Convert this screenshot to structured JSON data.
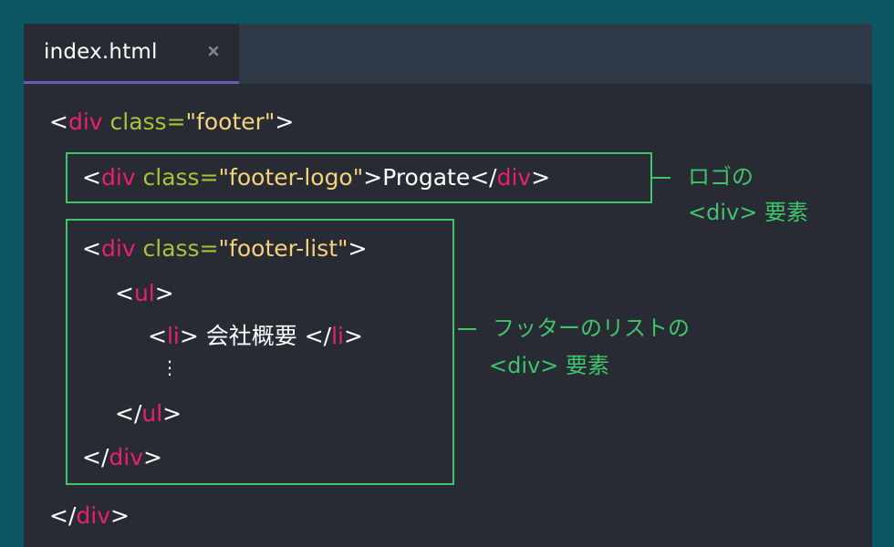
{
  "tab": {
    "filename": "index.html",
    "close_icon": "close-icon"
  },
  "code": {
    "line1": {
      "lt": "<",
      "tag": "div",
      "attr": " class=",
      "str": "\"footer\"",
      "gt": ">"
    },
    "line2": {
      "lt": "<",
      "tag": "div",
      "attr": " class=",
      "str": "\"footer-logo\"",
      "gt": ">",
      "text": "Progate",
      "close_lt": "</",
      "close_tag": "div",
      "close_gt": ">"
    },
    "line3": {
      "lt": "<",
      "tag": "div",
      "attr": " class=",
      "str": "\"footer-list\"",
      "gt": ">"
    },
    "line4": {
      "lt": "<",
      "tag": "ul",
      "gt": ">"
    },
    "line5": {
      "lt": "<",
      "tag": "li",
      "gt": ">",
      "text": " 会社概要 ",
      "close_lt": "</",
      "close_tag": "li",
      "close_gt": ">"
    },
    "line6": {
      "dots": "⋮"
    },
    "line7": {
      "lt": "</",
      "tag": "ul",
      "gt": ">"
    },
    "line8": {
      "lt": "</",
      "tag": "div",
      "gt": ">"
    },
    "line9": {
      "lt": "</",
      "tag": "div",
      "gt": ">"
    }
  },
  "annotations": {
    "logo": {
      "line1": "ロゴの",
      "line2": "<div> 要素"
    },
    "list": {
      "line1": "フッターのリストの",
      "line2": "<div> 要素"
    }
  },
  "colors": {
    "background": "#0d5764",
    "editor": "#282b33",
    "tabbar": "#313a48",
    "tab_underline": "#6a5bb0",
    "tag": "#ec1f6b",
    "attribute": "#a6c43a",
    "string": "#f4d27c",
    "highlight": "#3fc46b"
  }
}
